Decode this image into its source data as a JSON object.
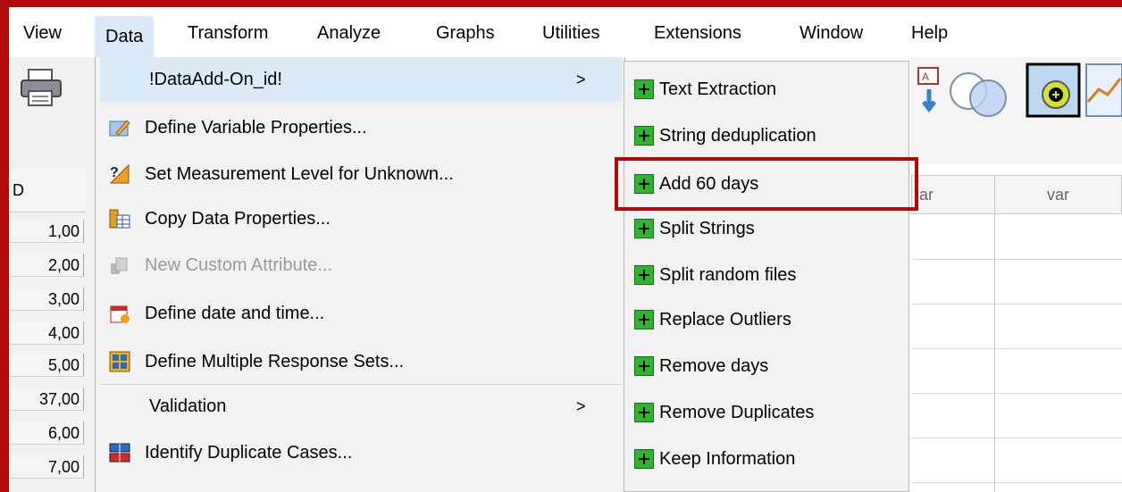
{
  "menubar": {
    "items": [
      {
        "label": "View"
      },
      {
        "label": "Data"
      },
      {
        "label": "Transform"
      },
      {
        "label": "Analyze"
      },
      {
        "label": "Graphs"
      },
      {
        "label": "Utilities"
      },
      {
        "label": "Extensions"
      },
      {
        "label": "Window"
      },
      {
        "label": "Help"
      }
    ]
  },
  "grid": {
    "first_col_header": "D",
    "var_headers": [
      "ar",
      "var"
    ],
    "rows": [
      "1,00",
      "2,00",
      "3,00",
      "4,00",
      "5,00",
      "37,00",
      "6,00",
      "7,00"
    ]
  },
  "data_menu": {
    "items": [
      {
        "label": "!DataAdd-On_id!",
        "has_submenu": true
      },
      {
        "label": "Define Variable Properties..."
      },
      {
        "label": "Set Measurement Level for Unknown..."
      },
      {
        "label": "Copy Data Properties..."
      },
      {
        "label": "New Custom Attribute...",
        "disabled": true
      },
      {
        "label": "Define date and time..."
      },
      {
        "label": "Define Multiple Response Sets..."
      },
      {
        "label": "Validation",
        "has_submenu": true
      },
      {
        "label": "Identify Duplicate Cases..."
      }
    ],
    "submenu_arrow": ">"
  },
  "sub_menu": {
    "items": [
      {
        "label": "Text Extraction"
      },
      {
        "label": "String deduplication"
      },
      {
        "label": "Add 60 days"
      },
      {
        "label": "Split Strings"
      },
      {
        "label": "Split random files"
      },
      {
        "label": "Replace Outliers"
      },
      {
        "label": "Remove days"
      },
      {
        "label": "Remove Duplicates"
      },
      {
        "label": "Keep Information"
      }
    ]
  },
  "colors": {
    "frame": "#b00a0a",
    "menu_highlight": "#dbe9f8",
    "plus_green": "#2db52d"
  }
}
